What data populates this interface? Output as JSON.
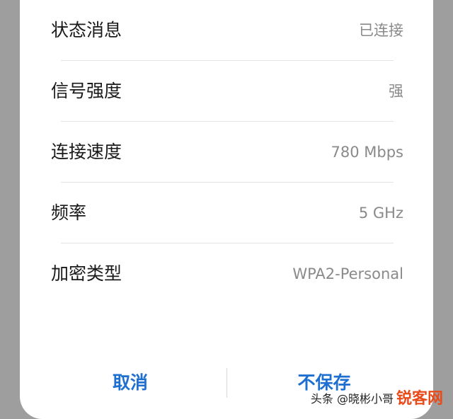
{
  "info_rows": [
    {
      "label": "状态消息",
      "value": "已连接"
    },
    {
      "label": "信号强度",
      "value": "强"
    },
    {
      "label": "连接速度",
      "value": "780 Mbps"
    },
    {
      "label": "频率",
      "value": "5 GHz"
    },
    {
      "label": "加密类型",
      "value": "WPA2-Personal"
    }
  ],
  "buttons": {
    "cancel_label": "取消",
    "nosave_label": "不保存"
  },
  "watermark": {
    "logo": "锐客网",
    "text": "头条 @晓彬小哥"
  },
  "colors": {
    "accent": "#1e6fd0",
    "label_text": "#1a1a1a",
    "value_text": "#8a8a8a",
    "backdrop": "#9e9e9e",
    "watermark_logo": "#e94a1a"
  }
}
